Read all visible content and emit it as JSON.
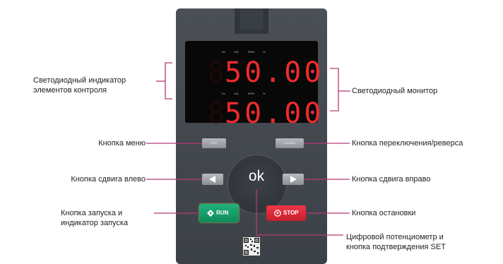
{
  "keypad": {
    "display": {
      "units": [
        "Hz",
        "V/A",
        "RPM",
        "%"
      ],
      "top_value": "50.00",
      "bottom_value": "50.00"
    },
    "keys": {
      "menu": "PRG",
      "shift": "JOG/REV",
      "center": "ok",
      "run": "RUN",
      "stop": "STOP"
    }
  },
  "labels": {
    "led_indicator_line1": "Светодиодный индикатор",
    "led_indicator_line2": "элементов контроля",
    "led_monitor": "Светодиодный монитор",
    "menu_button": "Кнопка меню",
    "switch_reverse_button": "Кнопка переключения/реверса",
    "shift_left_button": "Кнопка сдвига влево",
    "shift_right_button": "Кнопка сдвига вправо",
    "run_button_line1": "Кнопка запуска и",
    "run_button_line2": "индикатор запуска",
    "stop_button": "Кнопка остановки",
    "potentiometer_line1": "Цифровой потенциометр и",
    "potentiometer_line2": "кнопка подтверждения SET"
  },
  "colors": {
    "callout_line": "#b5397a",
    "led_red": "#ee2b2b",
    "run_green": "#13996a",
    "stop_red": "#e02a3a"
  }
}
